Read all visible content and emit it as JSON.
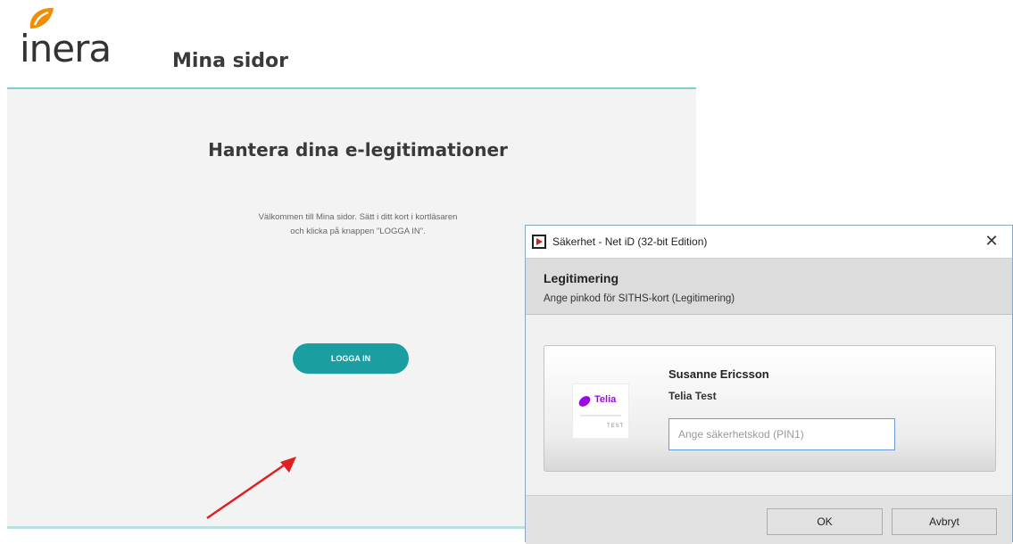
{
  "site": {
    "logo_text": "inera",
    "title": "Mina sidor"
  },
  "main": {
    "heading": "Hantera dina e-legitimationer",
    "welcome_line1": "Välkommen till Mina sidor. Sätt i ditt kort i kortläsaren",
    "welcome_line2": "och klicka på knappen \"LOGGA IN\".",
    "login_label": "LOGGA IN"
  },
  "dialog": {
    "title": "Säkerhet - Net iD (32-bit Edition)",
    "close_glyph": "✕",
    "section_title": "Legitimering",
    "section_subtitle": "Ange pinkod för SITHS-kort (Legitimering)",
    "card": {
      "issuer_name": "Telia",
      "issuer_tag": "TEST",
      "holder_name": "Susanne Ericsson",
      "organization": "Telia Test",
      "pin_placeholder": "Ange säkerhetskod (PIN1)",
      "pin_value": ""
    },
    "ok_label": "OK",
    "cancel_label": "Avbryt"
  },
  "colors": {
    "accent": "#1a9ea2",
    "header_line": "#7fcfcf",
    "logo_orange": "#f28c00",
    "telia_purple": "#990ae3",
    "arrow_red": "#e02020"
  },
  "icons": {
    "logo": "inera-leaf-icon",
    "app": "netid-app-icon",
    "close": "close-icon",
    "issuer": "telia-logo-icon",
    "annotation": "red-arrow-icon"
  }
}
